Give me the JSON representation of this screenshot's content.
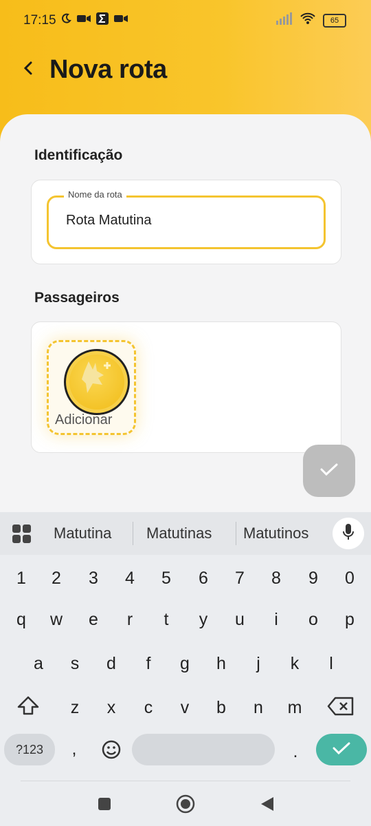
{
  "status": {
    "time": "17:15",
    "battery": "65"
  },
  "header": {
    "title": "Nova rota"
  },
  "identification": {
    "section_label": "Identificação",
    "field_label": "Nome da rota",
    "field_value": "Rota Matutina"
  },
  "passengers": {
    "section_label": "Passageiros",
    "add_label": "Adicionar"
  },
  "keyboard": {
    "suggestions": [
      "Matutina",
      "Matutinas",
      "Matutinos"
    ],
    "row_numbers": [
      "1",
      "2",
      "3",
      "4",
      "5",
      "6",
      "7",
      "8",
      "9",
      "0"
    ],
    "row1": [
      "q",
      "w",
      "e",
      "r",
      "t",
      "y",
      "u",
      "i",
      "o",
      "p"
    ],
    "row2": [
      "a",
      "s",
      "d",
      "f",
      "g",
      "h",
      "j",
      "k",
      "l"
    ],
    "row3": [
      "z",
      "x",
      "c",
      "v",
      "b",
      "n",
      "m"
    ],
    "symbols_label": "?123",
    "comma": ",",
    "period": "."
  },
  "colors": {
    "accent": "#f4c430",
    "enter": "#4ab7a5"
  }
}
